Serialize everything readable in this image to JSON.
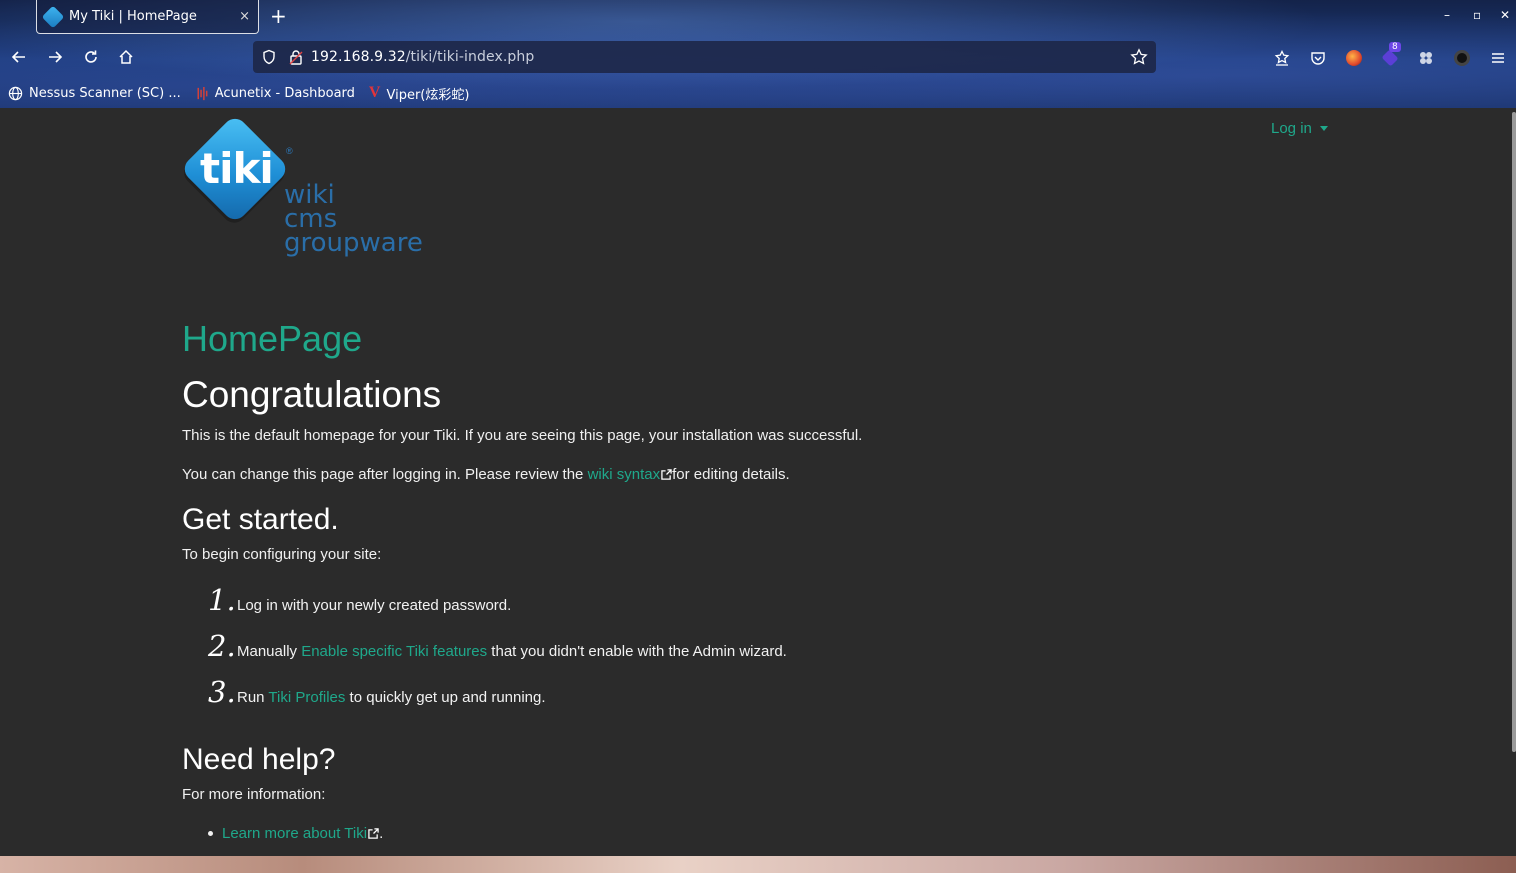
{
  "browser": {
    "tab": {
      "title": "My Tiki | HomePage",
      "close": "×"
    },
    "new_tab": "+",
    "window_controls": {
      "minimize": "–",
      "maximize": "▫",
      "close": "✕"
    },
    "url": {
      "host": "192.168.9.32",
      "path": "/tiki/tiki-index.php"
    },
    "toolbar_badge": "8",
    "bookmarks": [
      {
        "label": "Nessus Scanner (SC) ...",
        "icon": "globe-icon"
      },
      {
        "label": "Acunetix - Dashboard",
        "icon": "acunetix-icon"
      },
      {
        "label": "Viper(炫彩蛇)",
        "icon": "viper-icon"
      }
    ]
  },
  "page": {
    "login_label": "Log in",
    "logo": {
      "mark": "tiki",
      "reg": "®",
      "lines": [
        "wiki",
        "cms",
        "groupware"
      ]
    },
    "title": "HomePage",
    "heading": "Congratulations",
    "intro": "This is the default homepage for your Tiki. If you are seeing this page, your installation was successful.",
    "change": {
      "before": "You can change this page after logging in. Please review the ",
      "link": "wiki syntax",
      "after": "for editing details."
    },
    "get_started": {
      "heading": "Get started.",
      "lead": "To begin configuring your site:",
      "steps": [
        {
          "num": "1.",
          "before": "Log in with your newly created password.",
          "link": "",
          "after": ""
        },
        {
          "num": "2.",
          "before": "Manually ",
          "link": "Enable specific Tiki features",
          "after": " that you didn't enable with the Admin wizard."
        },
        {
          "num": "3.",
          "before": "Run ",
          "link": "Tiki Profiles",
          "after": " to quickly get up and running."
        }
      ]
    },
    "help": {
      "heading": "Need help?",
      "lead": "For more information:",
      "items": [
        {
          "link": "Learn more about Tiki",
          "after": "."
        }
      ]
    }
  },
  "colors": {
    "link": "#1fa88b",
    "page_bg": "#2b2b2b",
    "text": "#f0f0f0",
    "logo_blue": "#1f8fd6"
  }
}
